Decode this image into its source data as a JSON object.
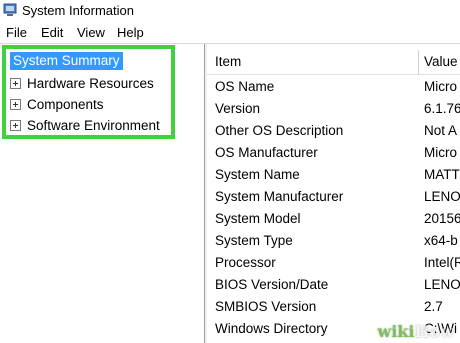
{
  "window": {
    "title": "System Information"
  },
  "menu": {
    "items": [
      "File",
      "Edit",
      "View",
      "Help"
    ]
  },
  "tree": {
    "root": "System Summary",
    "children": [
      "Hardware Resources",
      "Components",
      "Software Environment"
    ]
  },
  "table": {
    "headers": {
      "item": "Item",
      "value": "Value"
    },
    "rows": [
      {
        "item": "OS Name",
        "value": "Micro"
      },
      {
        "item": "Version",
        "value": "6.1.76"
      },
      {
        "item": "Other OS Description",
        "value": "Not A"
      },
      {
        "item": "OS Manufacturer",
        "value": "Micro"
      },
      {
        "item": "System Name",
        "value": "MATT"
      },
      {
        "item": "System Manufacturer",
        "value": "LENO"
      },
      {
        "item": "System Model",
        "value": "20156"
      },
      {
        "item": "System Type",
        "value": "x64-b"
      },
      {
        "item": "Processor",
        "value": "Intel(R"
      },
      {
        "item": "BIOS Version/Date",
        "value": "LENO"
      },
      {
        "item": "SMBIOS Version",
        "value": "2.7"
      },
      {
        "item": "Windows Directory",
        "value": "C:\\Wi"
      }
    ]
  },
  "watermark": {
    "part1": "wiki",
    "part2": "How"
  },
  "colors": {
    "selection": "#3399ff",
    "highlight_box": "#3fd13f"
  }
}
